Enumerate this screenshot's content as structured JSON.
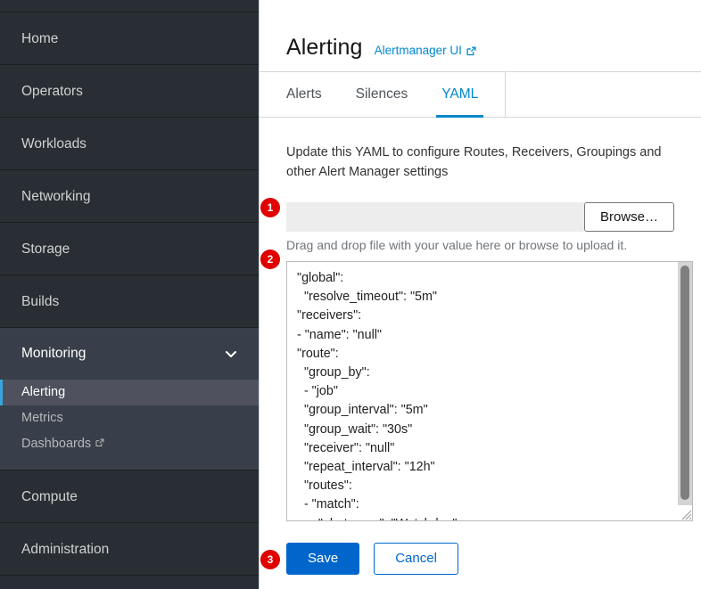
{
  "sidebar": {
    "items": [
      {
        "label": "Home",
        "icon": "",
        "type": "item"
      },
      {
        "label": "Operators",
        "icon": "",
        "type": "item"
      },
      {
        "label": "Workloads",
        "icon": "",
        "type": "item"
      },
      {
        "label": "Networking",
        "icon": "",
        "type": "item"
      },
      {
        "label": "Storage",
        "icon": "",
        "type": "item"
      },
      {
        "label": "Builds",
        "icon": "",
        "type": "item"
      }
    ],
    "section": {
      "label": "Monitoring",
      "expanded": true,
      "chevron_icon": "chevron-down-icon",
      "children": [
        {
          "label": "Alerting",
          "active": true,
          "external": false
        },
        {
          "label": "Metrics",
          "active": false,
          "external": false
        },
        {
          "label": "Dashboards",
          "active": false,
          "external": true,
          "external_icon": "external-link-icon"
        }
      ]
    },
    "items_after": [
      {
        "label": "Compute",
        "type": "item"
      },
      {
        "label": "Administration",
        "type": "item"
      }
    ],
    "colors": {
      "background": "#292e34",
      "section_background": "#383f4a",
      "active_background": "#4f525e",
      "active_bar": "#39a5dc",
      "text": "#d1d1d1",
      "active_text": "#ffffff"
    }
  },
  "header": {
    "title": "Alerting",
    "link_label": "Alertmanager UI",
    "link_icon": "external-link-icon"
  },
  "tabs": [
    {
      "label": "Alerts",
      "active": false
    },
    {
      "label": "Silences",
      "active": false
    },
    {
      "label": "YAML",
      "active": true
    }
  ],
  "main": {
    "description": "Update this YAML to configure Routes, Receivers, Groupings and other Alert Manager settings",
    "file_upload": {
      "value": "",
      "placeholder": "",
      "browse_label": "Browse…",
      "helper_text": "Drag and drop file with your value here or browse to upload it."
    },
    "editor": {
      "value": "\"global\":\n  \"resolve_timeout\": \"5m\"\n\"receivers\":\n- \"name\": \"null\"\n\"route\":\n  \"group_by\":\n  - \"job\"\n  \"group_interval\": \"5m\"\n  \"group_wait\": \"30s\"\n  \"receiver\": \"null\"\n  \"repeat_interval\": \"12h\"\n  \"routes\":\n  - \"match\":\n      \"alertname\": \"Watchdog\"",
      "scrollbar": "vertical-scrollbar",
      "resize_handle": "resize-grip-icon"
    },
    "buttons": {
      "save_label": "Save",
      "cancel_label": "Cancel"
    }
  },
  "annotations": [
    {
      "number": "1",
      "target": "file-upload-row"
    },
    {
      "number": "2",
      "target": "yaml-editor"
    },
    {
      "number": "3",
      "target": "save-button"
    }
  ],
  "colors": {
    "primary": "#0066cc",
    "link": "#0088ce",
    "badge": "#e00000"
  }
}
